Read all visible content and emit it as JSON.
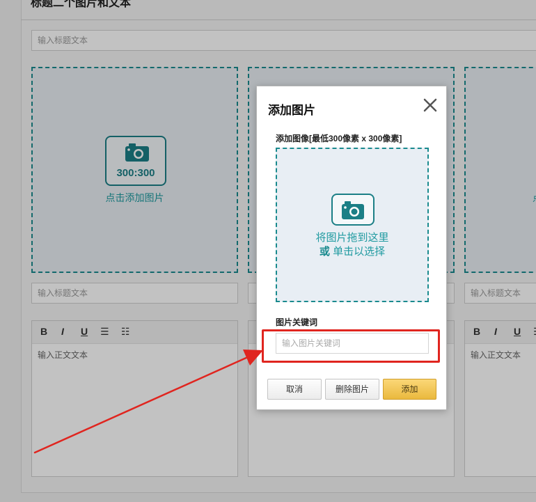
{
  "background": {
    "section_title": "标题二个图片和文本",
    "title_placeholder": "输入标题文本",
    "slot_caption_placeholder": "输入标题文本",
    "slot": {
      "ratio": "300:300",
      "hint": "点击添加图片",
      "hint_cut": "点"
    },
    "editor": {
      "bold": "B",
      "italic": "I",
      "underline": "U",
      "bullet_list": "☰",
      "numbered_list": "☷",
      "body_placeholder": "输入正文文本"
    }
  },
  "modal": {
    "title": "添加图片",
    "close": "✕",
    "image_label": "添加图像[最低300像素 x 300像素]",
    "drop_line1": "将图片拖到这里",
    "drop_or": "或",
    "drop_line2": " 单击以选择",
    "keyword_label": "图片关键词",
    "keyword_placeholder": "输入图片关键词",
    "keyword_value": "",
    "buttons": {
      "cancel": "取消",
      "delete": "删除图片",
      "add": "添加"
    }
  },
  "colors": {
    "teal": "#1a8a8e",
    "annotation_red": "#e0251f",
    "add_button": "#eab93e"
  }
}
